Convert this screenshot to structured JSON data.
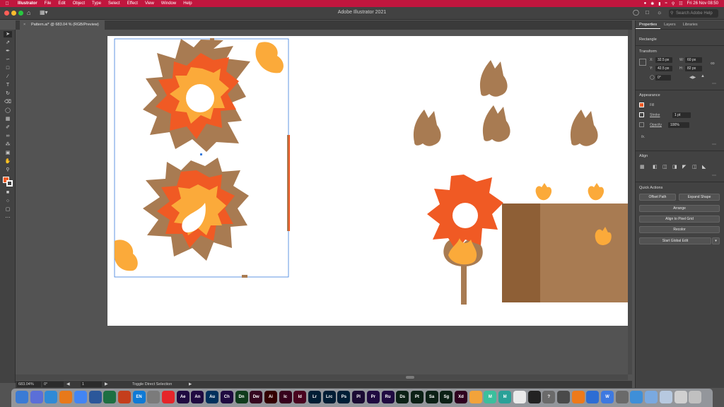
{
  "menubar": {
    "app": "Illustrator",
    "items": [
      "File",
      "Edit",
      "Object",
      "Type",
      "Select",
      "Effect",
      "View",
      "Window",
      "Help"
    ],
    "clock": "Fri 26 Nov  08:50"
  },
  "appbar": {
    "title": "Adobe Illustrator 2021",
    "search_placeholder": "Search Adobe Help"
  },
  "document": {
    "tab_label": "Pattern.ai* @ 683.04 % (RGB/Preview)"
  },
  "statusbar": {
    "zoom": "683.04%",
    "rotation": "0°",
    "artboard_num": "1",
    "tool_hint": "Toggle Direct Selection"
  },
  "panel": {
    "tabs": [
      "Properties",
      "Layers",
      "Libraries"
    ],
    "selection_type": "Rectangle",
    "transform": {
      "title": "Transform",
      "x": "32.5 px",
      "y": "42.5 px",
      "w": "60 px",
      "h": "82 px",
      "angle": "0°",
      "x_label": "X:",
      "y_label": "Y:",
      "w_label": "W:",
      "h_label": "H:"
    },
    "appearance": {
      "title": "Appearance",
      "fill_label": "Fill",
      "stroke_label": "Stroke",
      "stroke_weight": "1 pt",
      "opacity_label": "Opacity",
      "opacity": "100%",
      "fx": "fx."
    },
    "align": {
      "title": "Align"
    },
    "quick_actions": {
      "title": "Quick Actions",
      "offset_path": "Offset Path",
      "expand_shape": "Expand Shape",
      "arrange": "Arrange",
      "align_pixel": "Align to Pixel Grid",
      "recolor": "Recolor",
      "global_edit": "Start Global Edit"
    }
  },
  "dock": {
    "apps": [
      {
        "label": "",
        "color": "#3a7bd5",
        "name": "finder-icon"
      },
      {
        "label": "",
        "color": "#5b6fd8",
        "name": "launchpad-icon"
      },
      {
        "label": "",
        "color": "#2f8ad6",
        "name": "safari-icon"
      },
      {
        "label": "",
        "color": "#e8791a",
        "name": "firefox-icon"
      },
      {
        "label": "",
        "color": "#4285f4",
        "name": "chrome-icon"
      },
      {
        "label": "",
        "color": "#2b579a",
        "name": "outlook-icon"
      },
      {
        "label": "",
        "color": "#1d6f42",
        "name": "excel-icon"
      },
      {
        "label": "",
        "color": "#c43e1c",
        "name": "powerpoint-icon"
      },
      {
        "label": "EN",
        "color": "#0f7ad6",
        "name": "language-icon"
      },
      {
        "label": "",
        "color": "#7b7b7b",
        "name": "settings-icon"
      },
      {
        "label": "",
        "color": "#e5252a",
        "name": "acrobat-icon"
      },
      {
        "label": "Ae",
        "color": "#1f0a40",
        "name": "after-effects-icon"
      },
      {
        "label": "An",
        "color": "#1f0a40",
        "name": "animate-icon"
      },
      {
        "label": "Au",
        "color": "#00305c",
        "name": "audition-icon"
      },
      {
        "label": "Ch",
        "color": "#1f0a40",
        "name": "character-animator-icon"
      },
      {
        "label": "Dn",
        "color": "#0f3b1c",
        "name": "dimension-icon"
      },
      {
        "label": "Dw",
        "color": "#35061f",
        "name": "dreamweaver-icon"
      },
      {
        "label": "Ai",
        "color": "#330000",
        "name": "illustrator-icon"
      },
      {
        "label": "Ic",
        "color": "#36001c",
        "name": "incopy-icon"
      },
      {
        "label": "Id",
        "color": "#49021f",
        "name": "indesign-icon"
      },
      {
        "label": "Lr",
        "color": "#001d34",
        "name": "lightroom-icon"
      },
      {
        "label": "Lrc",
        "color": "#001d34",
        "name": "lightroom-classic-icon"
      },
      {
        "label": "Ps",
        "color": "#001e36",
        "name": "photoshop-icon"
      },
      {
        "label": "Pl",
        "color": "#1a0a33",
        "name": "prelude-icon"
      },
      {
        "label": "Pr",
        "color": "#1f0a40",
        "name": "premiere-icon"
      },
      {
        "label": "Ru",
        "color": "#1f0a40",
        "name": "rush-icon"
      },
      {
        "label": "Ds",
        "color": "#0b2015",
        "name": "substance-designer-icon"
      },
      {
        "label": "Pt",
        "color": "#0b2015",
        "name": "substance-painter-icon"
      },
      {
        "label": "Sa",
        "color": "#0b2015",
        "name": "substance-alchemist-icon"
      },
      {
        "label": "Sg",
        "color": "#0b2015",
        "name": "substance-stager-icon"
      },
      {
        "label": "Xd",
        "color": "#2e001f",
        "name": "xd-icon"
      },
      {
        "label": "",
        "color": "#f2a33a",
        "name": "blender-icon"
      },
      {
        "label": "M",
        "color": "#3bbf9d",
        "name": "mixamo-icon"
      },
      {
        "label": "M",
        "color": "#2aa198",
        "name": "meshmixer-icon"
      },
      {
        "label": "",
        "color": "#eaeaea",
        "name": "poser-icon"
      },
      {
        "label": "",
        "color": "#222222",
        "name": "unreal-icon"
      },
      {
        "label": "?",
        "color": "#6a6a6a",
        "name": "help-icon"
      },
      {
        "label": "",
        "color": "#4a4a4a",
        "name": "steam-icon"
      },
      {
        "label": "",
        "color": "#ee7a1a",
        "name": "vlc-icon"
      },
      {
        "label": "",
        "color": "#2d6dd4",
        "name": "keynote-icon"
      },
      {
        "label": "W",
        "color": "#3e79e0",
        "name": "webex-icon"
      },
      {
        "label": "",
        "color": "#6a6a6a",
        "name": "screenflow-icon"
      },
      {
        "label": "",
        "color": "#3f8fd8",
        "name": "network-icon"
      },
      {
        "label": "",
        "color": "#7aa9e0",
        "name": "folder-icon"
      },
      {
        "label": "",
        "color": "#b7c9e0",
        "name": "downloads-icon"
      },
      {
        "label": "",
        "color": "#d0d0d0",
        "name": "document-icon"
      },
      {
        "label": "",
        "color": "#c0c0c0",
        "name": "trash-icon"
      }
    ]
  },
  "colors": {
    "menubar": "#c1163e",
    "brown": "#a87b52",
    "orange": "#f05a24",
    "light_orange": "#fbaa3a",
    "selection_blue": "#3b7ddd",
    "crate_dark": "#8e5f36"
  }
}
